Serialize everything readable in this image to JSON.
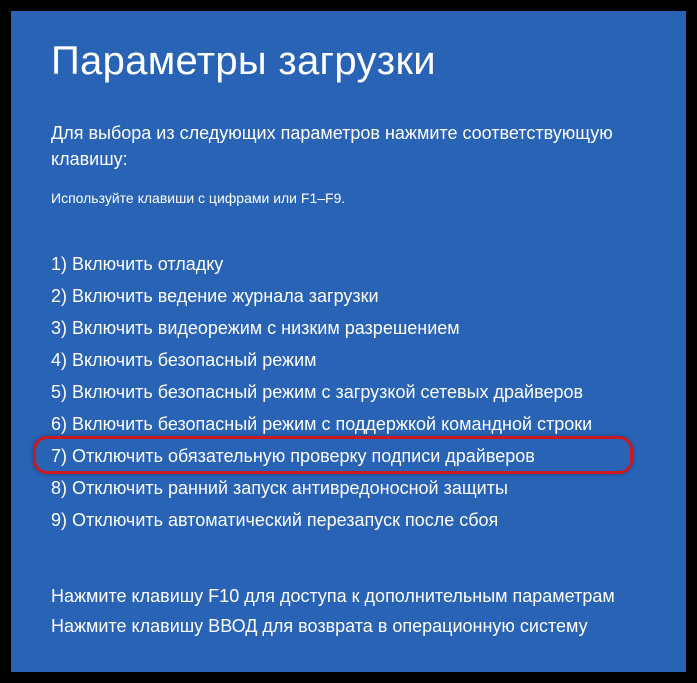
{
  "title": "Параметры загрузки",
  "instruction": "Для выбора из следующих параметров нажмите соответствующую клавишу:",
  "hint": "Используйте клавиши с цифрами или F1–F9.",
  "options": [
    "1) Включить отладку",
    "2) Включить ведение журнала загрузки",
    "3) Включить видеорежим с низким разрешением",
    "4) Включить безопасный режим",
    "5) Включить безопасный режим с загрузкой сетевых драйверов",
    "6) Включить безопасный режим с поддержкой командной строки",
    "7) Отключить обязательную проверку подписи драйверов",
    "8) Отключить ранний запуск антивредоносной защиты",
    "9) Отключить автоматический перезапуск после сбоя"
  ],
  "highlighted_index": 6,
  "footer": {
    "line1": "Нажмите клавишу F10 для доступа к дополнительным параметрам",
    "line2": "Нажмите клавишу ВВОД для возврата в операционную систему"
  }
}
